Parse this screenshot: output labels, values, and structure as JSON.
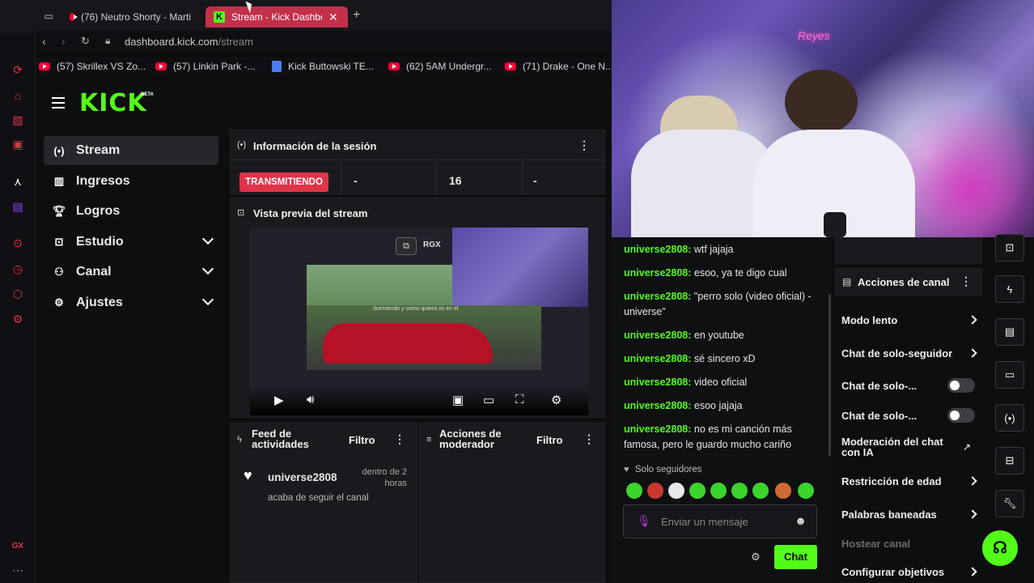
{
  "browser": {
    "tabs": [
      {
        "label": "(76) Neutro Shorty - Marti"
      },
      {
        "label": "Stream - Kick Dashbo"
      }
    ],
    "url_host": "dashboard.kick.com",
    "url_path": "/stream",
    "bookmarks": [
      {
        "label": "(57) Skrillex VS Zo..."
      },
      {
        "label": "(57) Linkin Park -..."
      },
      {
        "label": "Kick Buttowski TE..."
      },
      {
        "label": "(62) 5AM Undergr..."
      },
      {
        "label": "(71) Drake - One N..."
      }
    ],
    "gx_label": "GX"
  },
  "kick": {
    "logo": "KICK",
    "logo_badge": "BETA",
    "nav": [
      {
        "label": "Stream"
      },
      {
        "label": "Ingresos"
      },
      {
        "label": "Logros"
      },
      {
        "label": "Estudio"
      },
      {
        "label": "Canal"
      },
      {
        "label": "Ajustes"
      }
    ],
    "session": {
      "title": "Información de la sesión",
      "status": "TRANSMITIENDO",
      "stat1": "-",
      "stat2": "16",
      "stat3": "-"
    },
    "preview": {
      "title": "Vista previa del stream",
      "badge": "RGX",
      "caption": "durmiendo y como quiera vo en el"
    },
    "feed": {
      "title": "Feed de actividades",
      "filter": "Filtro",
      "user": "universe2808",
      "time": "dentro de 2 horas",
      "action": "acaba de seguir el canal"
    },
    "mod": {
      "title": "Acciones de moderador",
      "filter": "Filtro"
    }
  },
  "camera": {
    "neon_sign": "Reyes"
  },
  "chat": {
    "messages": [
      {
        "user": "universe2808:",
        "text": " wtf jajaja"
      },
      {
        "user": "universe2808:",
        "text": " esoo, ya te digo cual"
      },
      {
        "user": "universe2808:",
        "text": " \"perro solo (video oficial) - universe\""
      },
      {
        "user": "universe2808:",
        "text": " en youtube"
      },
      {
        "user": "universe2808:",
        "text": " sé sincero xD"
      },
      {
        "user": "universe2808:",
        "text": " video oficial"
      },
      {
        "user": "universe2808:",
        "text": " esoo jajaja"
      },
      {
        "user": "universe2808:",
        "text": " no es mi canción más famosa, pero le guardo mucho cariño"
      }
    ],
    "mode": "Solo seguidores",
    "placeholder": "Enviar un mensaje",
    "send_label": "Chat"
  },
  "actions": {
    "title": "Acciones de canal",
    "items": [
      {
        "label": "Modo lento"
      },
      {
        "label": "Chat de solo-seguidor"
      },
      {
        "label": "Chat de solo-..."
      },
      {
        "label": "Chat de solo-..."
      },
      {
        "label": "Moderación del chat con IA"
      },
      {
        "label": "Restricción de edad"
      },
      {
        "label": "Palabras baneadas"
      },
      {
        "label": "Hostear canal"
      },
      {
        "label": "Configurar objetivos"
      }
    ]
  },
  "colors": {
    "kick_green": "#53fc18",
    "live_red": "#e0344a",
    "opera_red": "#e0344a"
  }
}
